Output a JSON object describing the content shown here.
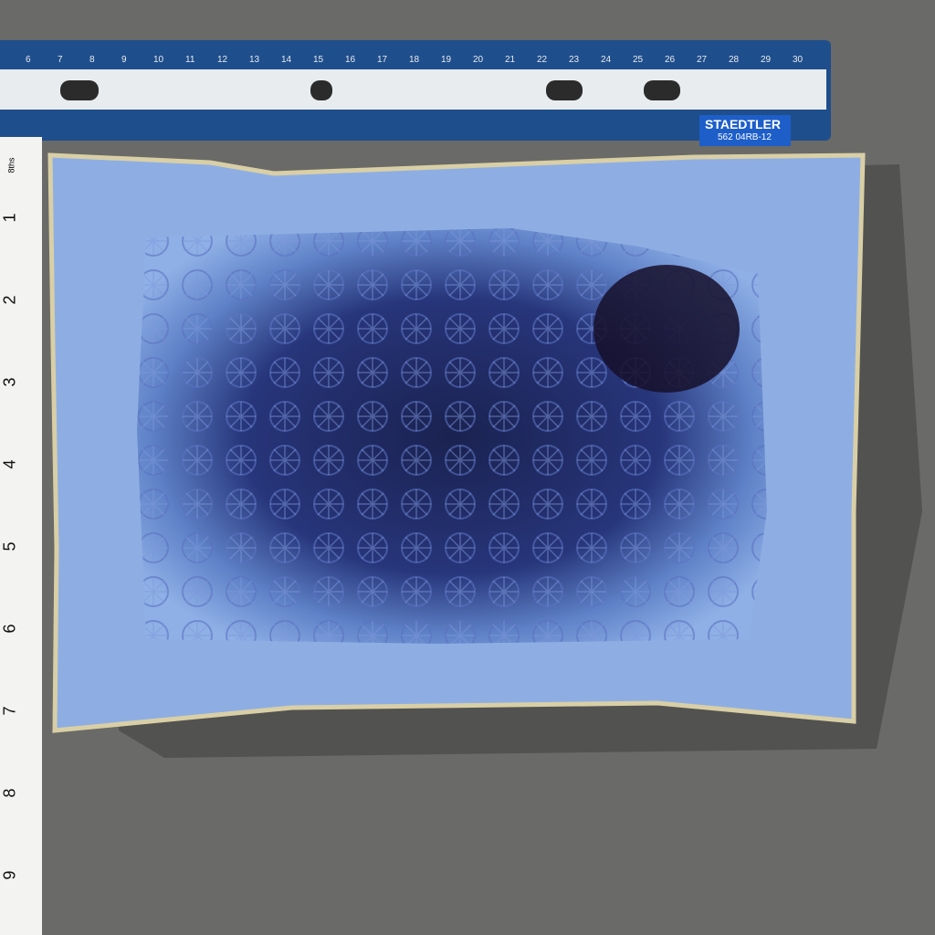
{
  "scene": {
    "ruler_top": {
      "brand": "STAEDTLER",
      "model": "562 04RB-12",
      "cm_labels": [
        "6",
        "7",
        "8",
        "9",
        "10",
        "11",
        "12",
        "13",
        "14",
        "15",
        "16",
        "17",
        "18",
        "19",
        "20",
        "21",
        "22",
        "23",
        "24",
        "25",
        "26",
        "27",
        "28",
        "29",
        "30"
      ]
    },
    "ruler_left": {
      "unit_label": "8ths",
      "inch_labels": [
        "1",
        "2",
        "3",
        "4",
        "5",
        "6",
        "7",
        "8",
        "9"
      ]
    }
  }
}
